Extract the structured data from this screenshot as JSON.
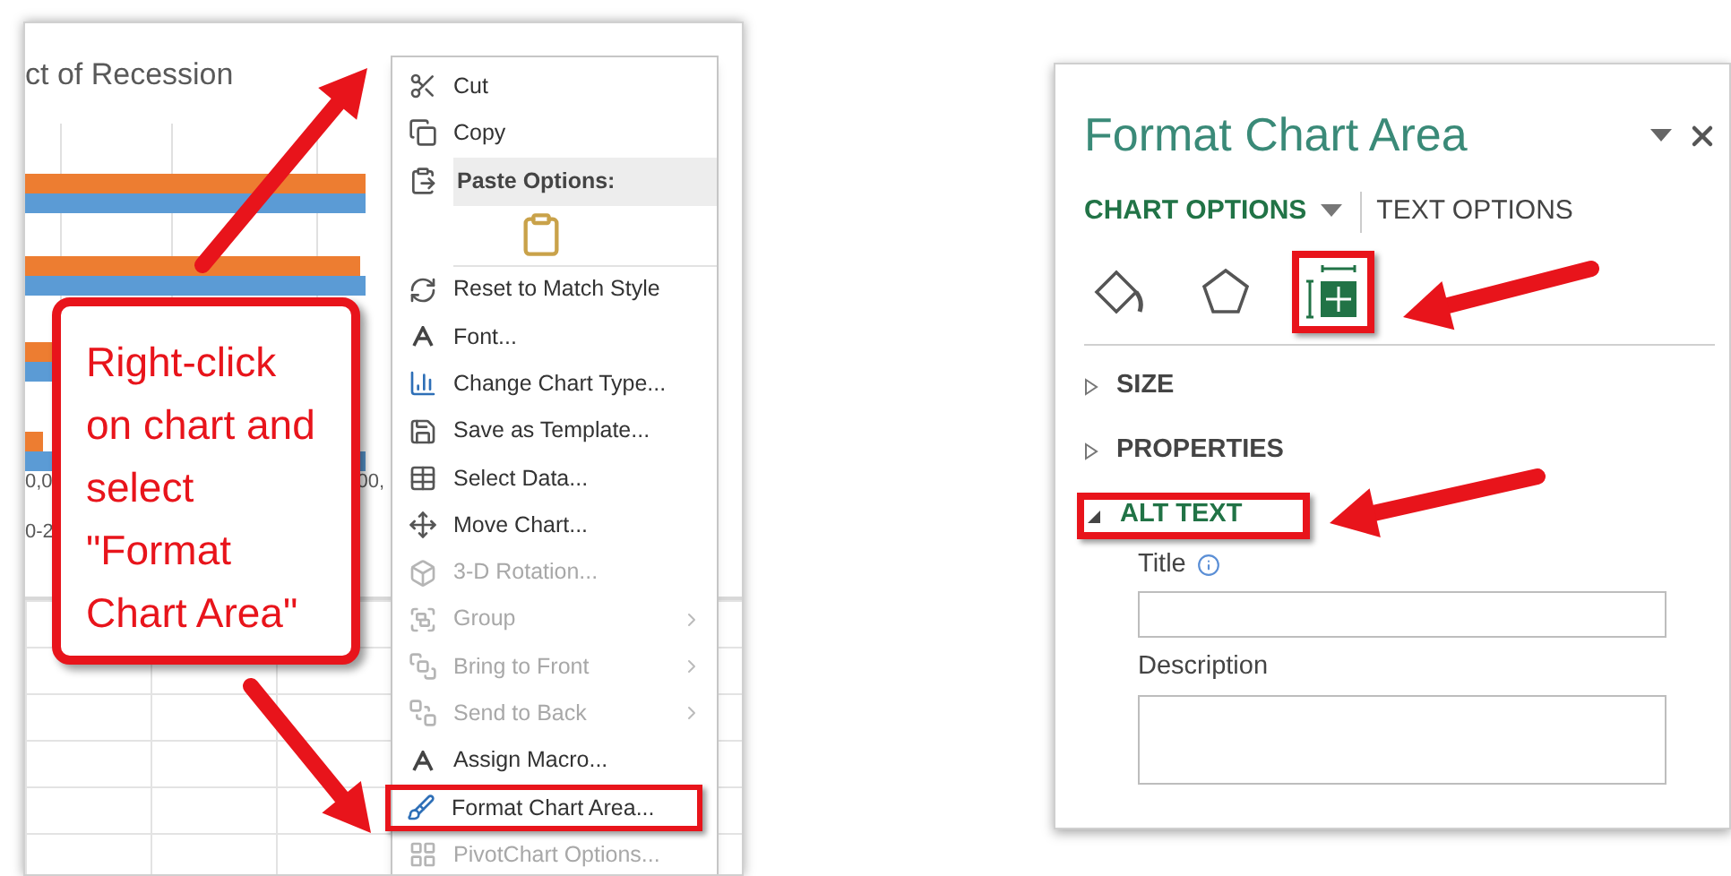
{
  "chart": {
    "title": "ct of Recession",
    "axis_labels": [
      "0,0",
      "00,",
      "0-2"
    ]
  },
  "context_menu": [
    {
      "label": "Cut",
      "kind": "item",
      "disabled": false,
      "submenu": false,
      "highlighted": false
    },
    {
      "label": "Copy",
      "kind": "item",
      "disabled": false,
      "submenu": false,
      "highlighted": false
    },
    {
      "label": "Paste Options:",
      "kind": "header"
    },
    {
      "kind": "paste-icon"
    },
    {
      "label": "Reset to Match Style",
      "kind": "item",
      "disabled": false,
      "submenu": false,
      "highlighted": false
    },
    {
      "label": "Font...",
      "kind": "item",
      "disabled": false,
      "submenu": false,
      "highlighted": false
    },
    {
      "label": "Change Chart Type...",
      "kind": "item",
      "disabled": false,
      "submenu": false,
      "highlighted": false
    },
    {
      "label": "Save as Template...",
      "kind": "item",
      "disabled": false,
      "submenu": false,
      "highlighted": false
    },
    {
      "label": "Select Data...",
      "kind": "item",
      "disabled": false,
      "submenu": false,
      "highlighted": false
    },
    {
      "label": "Move Chart...",
      "kind": "item",
      "disabled": false,
      "submenu": false,
      "highlighted": false
    },
    {
      "label": "3-D Rotation...",
      "kind": "item",
      "disabled": true,
      "submenu": false,
      "highlighted": false
    },
    {
      "label": "Group",
      "kind": "item",
      "disabled": true,
      "submenu": true,
      "highlighted": false
    },
    {
      "label": "Bring to Front",
      "kind": "item",
      "disabled": true,
      "submenu": true,
      "highlighted": false
    },
    {
      "label": "Send to Back",
      "kind": "item",
      "disabled": true,
      "submenu": true,
      "highlighted": false
    },
    {
      "label": "Assign Macro...",
      "kind": "item",
      "disabled": false,
      "submenu": false,
      "highlighted": false
    },
    {
      "label": "Format Chart Area...",
      "kind": "item",
      "disabled": false,
      "submenu": false,
      "highlighted": true
    },
    {
      "label": "PivotChart Options...",
      "kind": "item",
      "disabled": true,
      "submenu": false,
      "highlighted": false
    }
  ],
  "callout": {
    "text": "Right-click on chart and select \"Format Chart Area\""
  },
  "format_pane": {
    "title": "Format Chart Area",
    "tabs": [
      {
        "label": "CHART OPTIONS",
        "selected": true,
        "dropdown": true
      },
      {
        "label": "TEXT OPTIONS",
        "selected": false,
        "dropdown": false
      }
    ],
    "icon_tabs": [
      {
        "kind": "fill",
        "highlighted": false
      },
      {
        "kind": "effects",
        "highlighted": false
      },
      {
        "kind": "size",
        "highlighted": true
      }
    ],
    "sections": [
      {
        "label": "SIZE",
        "expanded": false,
        "highlighted": false
      },
      {
        "label": "PROPERTIES",
        "expanded": false,
        "highlighted": false
      },
      {
        "label": "ALT TEXT",
        "expanded": true,
        "highlighted": true
      }
    ],
    "fields": [
      {
        "label": "Title",
        "kind": "input",
        "info": true
      },
      {
        "label": "Description",
        "kind": "textarea",
        "info": false
      }
    ]
  }
}
